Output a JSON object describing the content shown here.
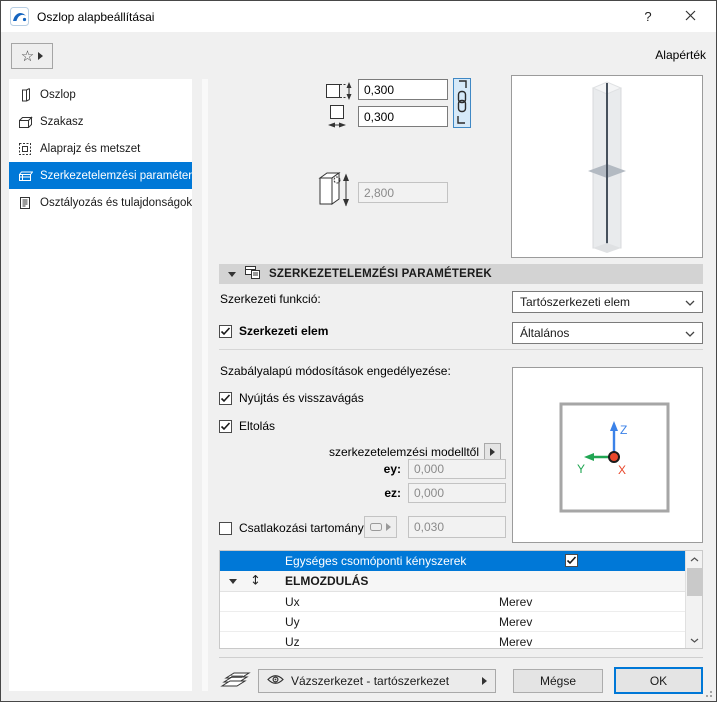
{
  "window": {
    "title": "Oszlop alapbeállításai",
    "help": "?"
  },
  "toolbar": {
    "default_label": "Alapérték"
  },
  "colors": {
    "accent": "#0078d7",
    "axis_z": "#3b82e8",
    "axis_y": "#21a653",
    "axis_x": "#e8472b"
  },
  "sidebar": {
    "items": [
      {
        "label": "Oszlop"
      },
      {
        "label": "Szakasz"
      },
      {
        "label": "Alaprajz és metszet"
      },
      {
        "label": "Szerkezetelemzési paraméter..."
      },
      {
        "label": "Osztályozás és tulajdonságok"
      }
    ]
  },
  "geometry": {
    "core_height": "0,300",
    "core_width": "0,300",
    "column_height": "2,800"
  },
  "structural": {
    "title": "SZERKEZETELEMZÉSI PARAMÉTEREK",
    "function_label": "Szerkezeti funkció:",
    "function_value": "Tartószerkezeti elem",
    "member_label": "Szerkezeti elem",
    "member_value": "Általános",
    "rules_label": "Szabályalapú módosítások engedélyezése:",
    "stretch_label": "Nyújtás és visszavágás",
    "offset_label": "Eltolás",
    "model_label": "szerkezetelemzési modelltől",
    "ey_label": "ey:",
    "ey_value": "0,000",
    "ez_label": "ez:",
    "ez_value": "0,000",
    "connection_label": "Csatlakozási tartomány",
    "connection_value": "0,030"
  },
  "axes": {
    "z": "Z",
    "y": "Y",
    "x": "X"
  },
  "constraints_table": {
    "header": "Egységes csomóponti kényszerek",
    "group": "ELMOZDULÁS",
    "rows": [
      {
        "name": "Ux",
        "value": "Merev"
      },
      {
        "name": "Uy",
        "value": "Merev"
      },
      {
        "name": "Uz",
        "value": "Merev"
      }
    ]
  },
  "footer": {
    "layer_value": "Vázszerkezet - tartószerkezet",
    "cancel_label": "Mégse",
    "ok_label": "OK"
  }
}
